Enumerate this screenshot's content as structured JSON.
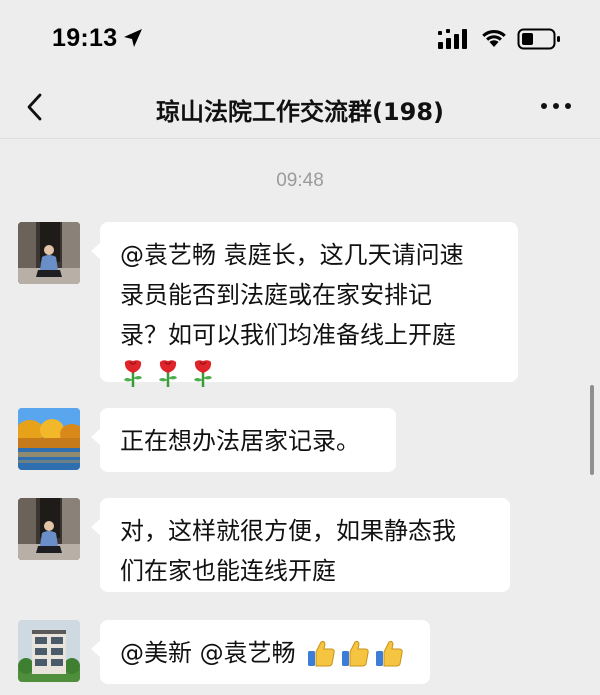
{
  "status_bar": {
    "time": "19:13",
    "icons": [
      "location-arrow-icon",
      "cellular-signal-icon",
      "wifi-icon",
      "battery-icon"
    ]
  },
  "nav": {
    "title": "琼山法院工作交流群(198)",
    "back_icon": "chevron-left-icon",
    "more_icon": "more-dots-icon"
  },
  "chat": {
    "timestamp": "09:48",
    "messages": [
      {
        "sender_avatar": "person-seated-avatar",
        "lines": [
          "@袁艺畅 袁庭长，这几天请问速",
          "录员能否到法庭或在家安排记",
          "录？如可以我们均准备线上开庭"
        ],
        "emojis": [
          "rose-emoji",
          "rose-emoji",
          "rose-emoji"
        ]
      },
      {
        "sender_avatar": "autumn-landscape-avatar",
        "lines": [
          "正在想办法居家记录。"
        ],
        "emojis": []
      },
      {
        "sender_avatar": "person-seated-avatar",
        "lines": [
          "对，这样就很方便，如果静态我",
          "们在家也能连线开庭"
        ],
        "emojis": []
      },
      {
        "sender_avatar": "building-avatar",
        "lines": [
          "@美新 @袁艺畅"
        ],
        "emojis": [
          "thumbs-up-emoji",
          "thumbs-up-emoji",
          "thumbs-up-emoji"
        ]
      }
    ]
  },
  "colors": {
    "background": "#ededed",
    "bubble": "#ffffff",
    "timestamp": "#9b9b9b"
  }
}
